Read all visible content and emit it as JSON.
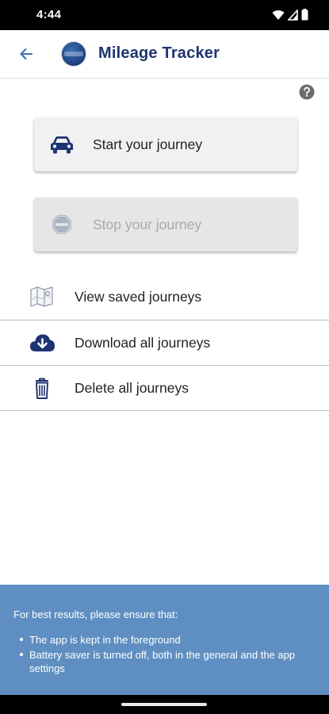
{
  "status_bar": {
    "time": "4:44",
    "icons": [
      "wifi-icon",
      "signal-icon",
      "battery-icon"
    ]
  },
  "app_bar": {
    "title": "Mileage Tracker",
    "back_icon": "arrow-left-icon",
    "logo": "app-logo",
    "accent_color": "#1e3470"
  },
  "help": {
    "icon": "help-circle-icon"
  },
  "actions": {
    "start": {
      "label": "Start your journey",
      "icon": "car-icon",
      "enabled": true
    },
    "stop": {
      "label": "Stop your journey",
      "icon": "stop-sign-icon",
      "enabled": false
    }
  },
  "menu": [
    {
      "label": "View saved journeys",
      "icon": "map-icon"
    },
    {
      "label": "Download all journeys",
      "icon": "cloud-download-icon"
    },
    {
      "label": "Delete all journeys",
      "icon": "trash-icon"
    }
  ],
  "info": {
    "heading": "For best results, please ensure that:",
    "items": [
      "The app is kept in the foreground",
      "Battery saver is turned off, both in the general and the app settings"
    ],
    "background_color": "#5f8fc2"
  }
}
